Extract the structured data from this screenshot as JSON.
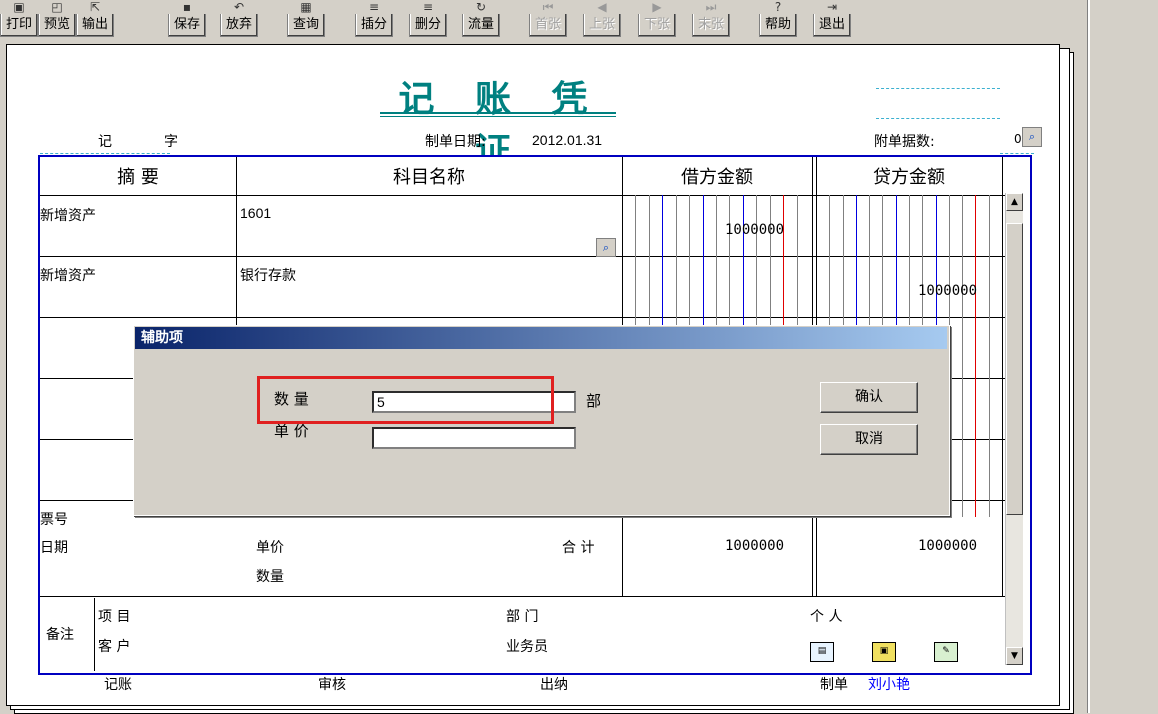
{
  "toolbar": {
    "buttons": [
      {
        "label": "打印",
        "enabled": true
      },
      {
        "label": "预览",
        "enabled": true
      },
      {
        "label": "输出",
        "enabled": true
      },
      {
        "label": "保存",
        "enabled": true
      },
      {
        "label": "放弃",
        "enabled": true
      },
      {
        "label": "查询",
        "enabled": true
      },
      {
        "label": "插分",
        "enabled": true
      },
      {
        "label": "删分",
        "enabled": true
      },
      {
        "label": "流量",
        "enabled": true
      },
      {
        "label": "首张",
        "enabled": false
      },
      {
        "label": "上张",
        "enabled": false
      },
      {
        "label": "下张",
        "enabled": false
      },
      {
        "label": "末张",
        "enabled": false
      },
      {
        "label": "帮助",
        "enabled": true
      },
      {
        "label": "退出",
        "enabled": true
      }
    ]
  },
  "voucher": {
    "title": "记 账 凭 证",
    "type_char1": "记",
    "type_char2": "字",
    "date_label": "制单日期:",
    "date_value": "2012.01.31",
    "attach_label": "附单据数:",
    "attach_value": "0",
    "headers": {
      "summary": "摘  要",
      "account": "科目名称",
      "debit": "借方金额",
      "credit": "贷方金额"
    },
    "rows": [
      {
        "summary": "新增资产",
        "account": "1601",
        "debit": "1000000",
        "credit": ""
      },
      {
        "summary": "新增资产",
        "account": "银行存款",
        "debit": "",
        "credit": "1000000"
      }
    ],
    "footer": {
      "ticket_label": "票号",
      "date_label": "日期",
      "unit_price_label": "单价",
      "quantity_label": "数量",
      "total_label": "合 计",
      "total_debit": "1000000",
      "total_credit": "1000000"
    },
    "remarks": {
      "remarks_label": "备注",
      "project_label": "项  目",
      "customer_label": "客  户",
      "dept_label": "部  门",
      "salesman_label": "业务员",
      "person_label": "个  人"
    },
    "signatures": {
      "posting": "记账",
      "audit": "审核",
      "cashier": "出纳",
      "maker_label": "制单",
      "maker_name": "刘小艳"
    }
  },
  "dialog": {
    "title": "辅助项",
    "quantity_label": "数   量",
    "quantity_value": "5",
    "quantity_unit": "部",
    "unit_price_label": "单   价",
    "unit_price_value": "",
    "confirm_label": "确认",
    "cancel_label": "取消"
  },
  "colors": {
    "title_teal": "#008080",
    "grid_blue": "#0000c0",
    "maker_name_blue": "#0000ff",
    "highlight_red": "#e02020",
    "dialog_title_start": "#0a246a",
    "dialog_title_end": "#a6caf0"
  },
  "icons": [
    "printer-icon",
    "preview-icon",
    "export-icon",
    "save-icon",
    "discard-icon",
    "query-icon",
    "insert-row-icon",
    "delete-row-icon",
    "cashflow-icon",
    "first-icon",
    "prev-icon",
    "next-icon",
    "last-icon",
    "help-icon",
    "exit-icon",
    "magnifier-icon"
  ]
}
